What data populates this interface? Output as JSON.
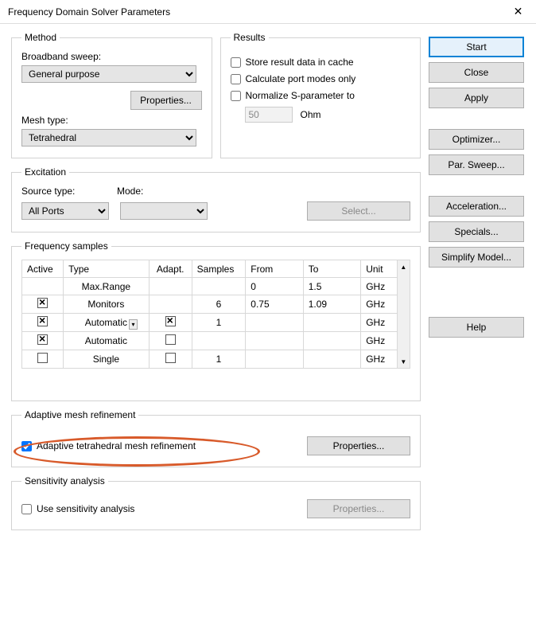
{
  "window": {
    "title": "Frequency Domain Solver Parameters"
  },
  "method": {
    "legend": "Method",
    "broadband_label": "Broadband sweep:",
    "broadband_value": "General purpose",
    "properties_btn": "Properties...",
    "mesh_label": "Mesh type:",
    "mesh_value": "Tetrahedral"
  },
  "results": {
    "legend": "Results",
    "store_label": "Store result data in cache",
    "calc_label": "Calculate port modes only",
    "norm_label": "Normalize S-parameter to",
    "ohm_value": "50",
    "ohm_unit": "Ohm"
  },
  "excitation": {
    "legend": "Excitation",
    "source_label": "Source type:",
    "source_value": "All Ports",
    "mode_label": "Mode:",
    "select_btn": "Select..."
  },
  "freq": {
    "legend": "Frequency samples",
    "headers": {
      "active": "Active",
      "type": "Type",
      "adapt": "Adapt.",
      "samples": "Samples",
      "from": "From",
      "to": "To",
      "unit": "Unit"
    },
    "rows": [
      {
        "active": null,
        "type": "Max.Range",
        "adapt": null,
        "samples": "",
        "from": "0",
        "to": "1.5",
        "unit": "GHz",
        "type_dd": false
      },
      {
        "active": true,
        "type": "Monitors",
        "adapt": null,
        "samples": "6",
        "from": "0.75",
        "to": "1.09",
        "unit": "GHz",
        "type_dd": false
      },
      {
        "active": true,
        "type": "Automatic",
        "adapt": true,
        "samples": "1",
        "from": "",
        "to": "",
        "unit": "GHz",
        "type_dd": true
      },
      {
        "active": true,
        "type": "Automatic",
        "adapt": false,
        "samples": "",
        "from": "",
        "to": "",
        "unit": "GHz",
        "type_dd": false
      },
      {
        "active": false,
        "type": "Single",
        "adapt": false,
        "samples": "1",
        "from": "",
        "to": "",
        "unit": "GHz",
        "type_dd": false
      }
    ]
  },
  "adaptive": {
    "legend": "Adaptive mesh refinement",
    "chk_label": "Adaptive tetrahedral mesh refinement",
    "properties_btn": "Properties..."
  },
  "sensitivity": {
    "legend": "Sensitivity analysis",
    "chk_label": "Use sensitivity analysis",
    "properties_btn": "Properties..."
  },
  "sidebar": {
    "start": "Start",
    "close": "Close",
    "apply": "Apply",
    "optimizer": "Optimizer...",
    "par_sweep": "Par. Sweep...",
    "acceleration": "Acceleration...",
    "specials": "Specials...",
    "simplify": "Simplify Model...",
    "help": "Help"
  }
}
